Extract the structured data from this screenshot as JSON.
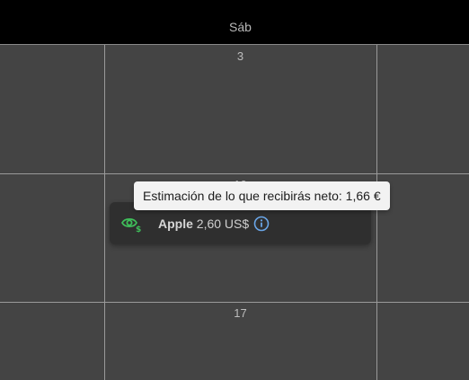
{
  "calendar": {
    "header_day": "Sáb",
    "days": [
      "3",
      "10",
      "17"
    ]
  },
  "event": {
    "ticker": "Apple",
    "amount": "2,60 US$",
    "status_icon": "eye-dollar-icon",
    "info_icon": "info-circle-icon"
  },
  "tooltip": {
    "text": "Estimación de lo que recibirás neto: 1,66 €"
  },
  "colors": {
    "background": "#444444",
    "header": "#000000",
    "card": "#2f2f2f",
    "accent_green": "#3fbf5a",
    "info_blue": "#6aa6e8"
  }
}
